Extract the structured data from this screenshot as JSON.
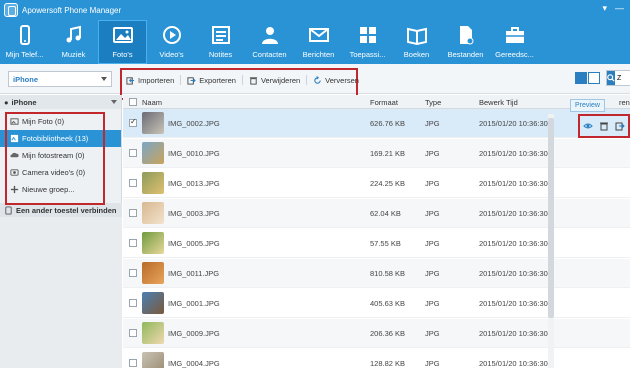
{
  "app": {
    "title": "Apowersoft Phone Manager"
  },
  "window": {
    "controls": [
      "▾",
      "—"
    ]
  },
  "colors": {
    "header": "#2a93d5",
    "active_nav": "#1a7ec1",
    "highlight_box": "#c0282d",
    "selected_row": "#d9eaf8"
  },
  "nav": {
    "items": [
      {
        "label": "Mijn Telef...",
        "icon": "phone-icon"
      },
      {
        "label": "Muziek",
        "icon": "music-icon"
      },
      {
        "label": "Foto's",
        "icon": "photo-icon",
        "active": true
      },
      {
        "label": "Video's",
        "icon": "video-icon"
      },
      {
        "label": "Notites",
        "icon": "notes-icon"
      },
      {
        "label": "Contacten",
        "icon": "contacts-icon"
      },
      {
        "label": "Berichten",
        "icon": "messages-icon"
      },
      {
        "label": "Toepassi...",
        "icon": "apps-icon"
      },
      {
        "label": "Boeken",
        "icon": "books-icon"
      },
      {
        "label": "Bestanden",
        "icon": "files-icon"
      },
      {
        "label": "Gereedsc...",
        "icon": "toolbox-icon"
      }
    ]
  },
  "toolbar": {
    "device": "iPhone",
    "actions": [
      {
        "label": "Importeren",
        "icon": "import-icon"
      },
      {
        "label": "Exporteren",
        "icon": "export-icon"
      },
      {
        "label": "Verwijderen",
        "icon": "trash-icon"
      },
      {
        "label": "Verversen",
        "icon": "refresh-icon"
      }
    ],
    "search_text": "Z"
  },
  "sidebar": {
    "device_header": "iPhone",
    "items": [
      {
        "label": "Mijn Foto (0)",
        "icon": "photo-album-icon"
      },
      {
        "label": "Fotobibliotheek (13)",
        "icon": "library-icon",
        "active": true
      },
      {
        "label": "Mijn fotostream (0)",
        "icon": "cloud-icon"
      },
      {
        "label": "Camera video's (0)",
        "icon": "camera-video-icon"
      },
      {
        "label": "Nieuwe groep...",
        "icon": "plus-icon"
      }
    ],
    "connect": "Een ander toestel verbinden"
  },
  "table": {
    "columns": {
      "name": "Naam",
      "format": "Formaat",
      "type": "Type",
      "edited": "Bewerk Tijd",
      "extra": "ren"
    },
    "tooltip": "Preview",
    "rows": [
      {
        "name": "IMG_0002.JPG",
        "size": "626.76 KB",
        "type": "JPG",
        "time": "2015/01/20 10:36:30",
        "checked": true,
        "selected": true,
        "thumb": [
          "#6b6b75",
          "#c9c4b8"
        ]
      },
      {
        "name": "IMG_0010.JPG",
        "size": "169.21 KB",
        "type": "JPG",
        "time": "2015/01/20 10:36:30",
        "checked": false,
        "thumb": [
          "#7aa6c8",
          "#c9a35b"
        ]
      },
      {
        "name": "IMG_0013.JPG",
        "size": "224.25 KB",
        "type": "JPG",
        "time": "2015/01/20 10:36:30",
        "checked": false,
        "thumb": [
          "#8c9b5a",
          "#e0c070"
        ]
      },
      {
        "name": "IMG_0003.JPG",
        "size": "62.04 KB",
        "type": "JPG",
        "time": "2015/01/20 10:36:30",
        "checked": false,
        "thumb": [
          "#d8b890",
          "#f2e2cc"
        ]
      },
      {
        "name": "IMG_0005.JPG",
        "size": "57.55 KB",
        "type": "JPG",
        "time": "2015/01/20 10:36:30",
        "checked": false,
        "thumb": [
          "#6f9a3e",
          "#e8d89a"
        ]
      },
      {
        "name": "IMG_0011.JPG",
        "size": "810.58 KB",
        "type": "JPG",
        "time": "2015/01/20 10:36:30",
        "checked": false,
        "thumb": [
          "#b86b2a",
          "#e9a55a"
        ]
      },
      {
        "name": "IMG_0001.JPG",
        "size": "405.63 KB",
        "type": "JPG",
        "time": "2015/01/20 10:36:30",
        "checked": false,
        "thumb": [
          "#4a7fb5",
          "#7b5a3a"
        ]
      },
      {
        "name": "IMG_0009.JPG",
        "size": "206.36 KB",
        "type": "JPG",
        "time": "2015/01/20 10:36:30",
        "checked": false,
        "thumb": [
          "#8fb85a",
          "#f0d8b0"
        ]
      },
      {
        "name": "IMG_0004.JPG",
        "size": "128.82 KB",
        "type": "JPG",
        "time": "2015/01/20 10:36:30",
        "checked": false,
        "thumb": [
          "#c8c2b4",
          "#9a8a70"
        ]
      }
    ]
  },
  "row_tools": [
    {
      "icon": "eye-icon"
    },
    {
      "icon": "trash-icon"
    },
    {
      "icon": "export-icon"
    }
  ]
}
